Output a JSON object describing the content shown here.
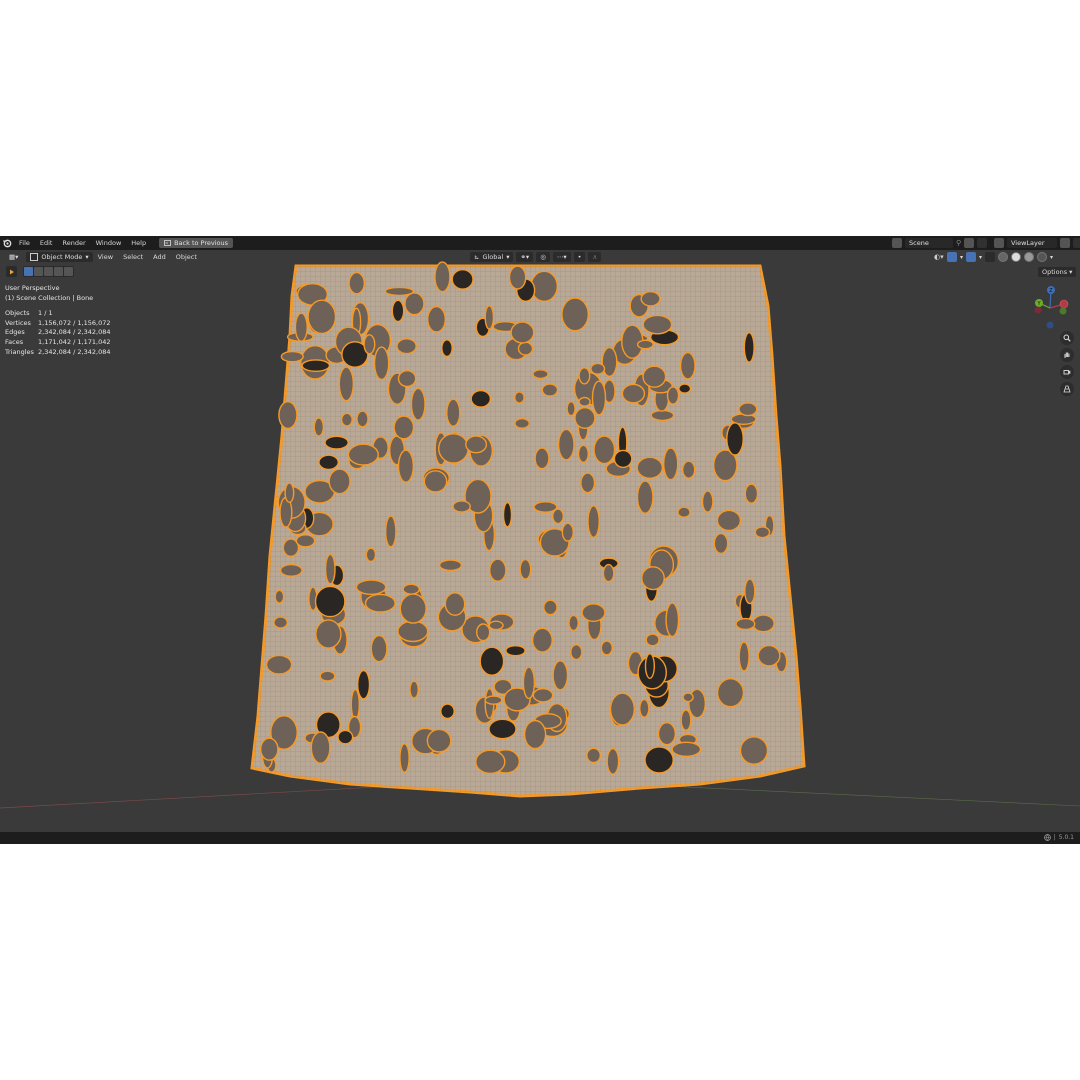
{
  "topbar": {
    "menus": [
      "File",
      "Edit",
      "Render",
      "Window",
      "Help"
    ],
    "back_label": "Back to Previous",
    "scene": "Scene",
    "view_layer": "ViewLayer"
  },
  "viewport_header": {
    "mode": "Object Mode",
    "menus": [
      "View",
      "Select",
      "Add",
      "Object"
    ],
    "transform_orientation": "Global",
    "options_label": "Options"
  },
  "overlay": {
    "perspective": "User Perspective",
    "collection": "(1) Scene Collection | Bone",
    "stats": [
      {
        "label": "Objects",
        "value": "1 / 1"
      },
      {
        "label": "Vertices",
        "value": "1,156,072 / 1,156,072"
      },
      {
        "label": "Edges",
        "value": "2,342,084 / 2,342,084"
      },
      {
        "label": "Faces",
        "value": "1,171,042 / 1,171,042"
      },
      {
        "label": "Triangles",
        "value": "2,342,084 / 2,342,084"
      }
    ]
  },
  "gizmo": {
    "z": "Z",
    "y": "Y"
  },
  "statusbar": {
    "version": "5.0.1"
  },
  "colors": {
    "selection_orange": "#f49a2a",
    "mesh_base": "#b9a896",
    "viewport_bg": "#3a3a3a",
    "header_bg": "#1d1d1d",
    "accent_blue": "#4772b3"
  },
  "icons": [
    "blender-logo",
    "back-icon",
    "scene-icon",
    "pin-icon",
    "viewlayer-icon",
    "editor-type-icon",
    "mode-icon",
    "play-icon",
    "zoom-icon",
    "hand-icon",
    "camera-icon",
    "grid-icon",
    "globe-icon"
  ]
}
